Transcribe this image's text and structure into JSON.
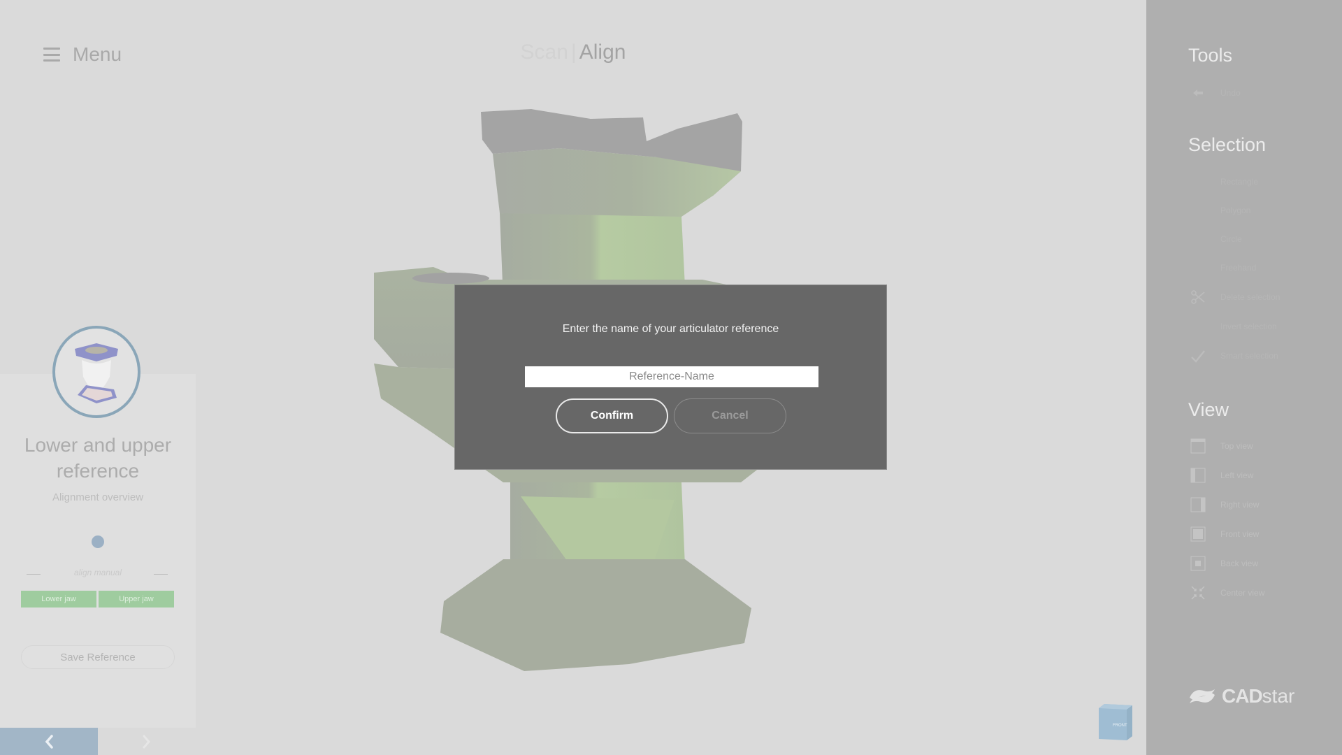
{
  "header": {
    "menu_label": "Menu",
    "breadcrumb_inactive": "Scan",
    "breadcrumb_separator": "|",
    "breadcrumb_active": "Align"
  },
  "left_panel": {
    "step_title": "Lower and upper reference",
    "step_subtitle": "Alignment overview",
    "mode_label": "align manual",
    "jaw_buttons": [
      "Lower jaw",
      "Upper jaw"
    ],
    "save_reference_label": "Save Reference",
    "nav_prev_icon": "chevron-left-icon",
    "nav_next_icon": "chevron-right-icon"
  },
  "viewport": {
    "view_cube_label": "FRONT"
  },
  "right_panel": {
    "tools_title": "Tools",
    "tools_items": [
      {
        "label": "Undo",
        "icon": "undo-icon"
      }
    ],
    "selection_title": "Selection",
    "selection_items": [
      {
        "label": "Rectangle",
        "icon": "rectangle-select-icon"
      },
      {
        "label": "Polygon",
        "icon": "polygon-select-icon"
      },
      {
        "label": "Circle",
        "icon": "circle-select-icon"
      },
      {
        "label": "Freehand",
        "icon": "freehand-select-icon"
      },
      {
        "label": "Delete selection",
        "icon": "scissors-icon"
      },
      {
        "label": "Invert selection",
        "icon": "invert-selection-icon"
      },
      {
        "label": "Smart selection",
        "icon": "checkmark-icon"
      }
    ],
    "view_title": "View",
    "view_items": [
      {
        "label": "Top view",
        "icon": "top-view-icon"
      },
      {
        "label": "Left view",
        "icon": "left-view-icon"
      },
      {
        "label": "Right view",
        "icon": "right-view-icon"
      },
      {
        "label": "Front view",
        "icon": "front-view-icon"
      },
      {
        "label": "Back view",
        "icon": "back-view-icon"
      },
      {
        "label": "Center view",
        "icon": "center-view-icon"
      }
    ],
    "logo_bold": "CAD",
    "logo_light": "star"
  },
  "dialog": {
    "title": "Enter the name of your articulator reference",
    "input_placeholder": "Reference-Name",
    "input_value": "",
    "confirm_label": "Confirm",
    "cancel_label": "Cancel"
  },
  "colors": {
    "background": "#dadada",
    "right_panel": "#afafaf",
    "dialog": "#676767",
    "accent_blue": "#8aa6b8",
    "jaw_green": "#9fcc9f",
    "model_green": "#a9c49a"
  }
}
